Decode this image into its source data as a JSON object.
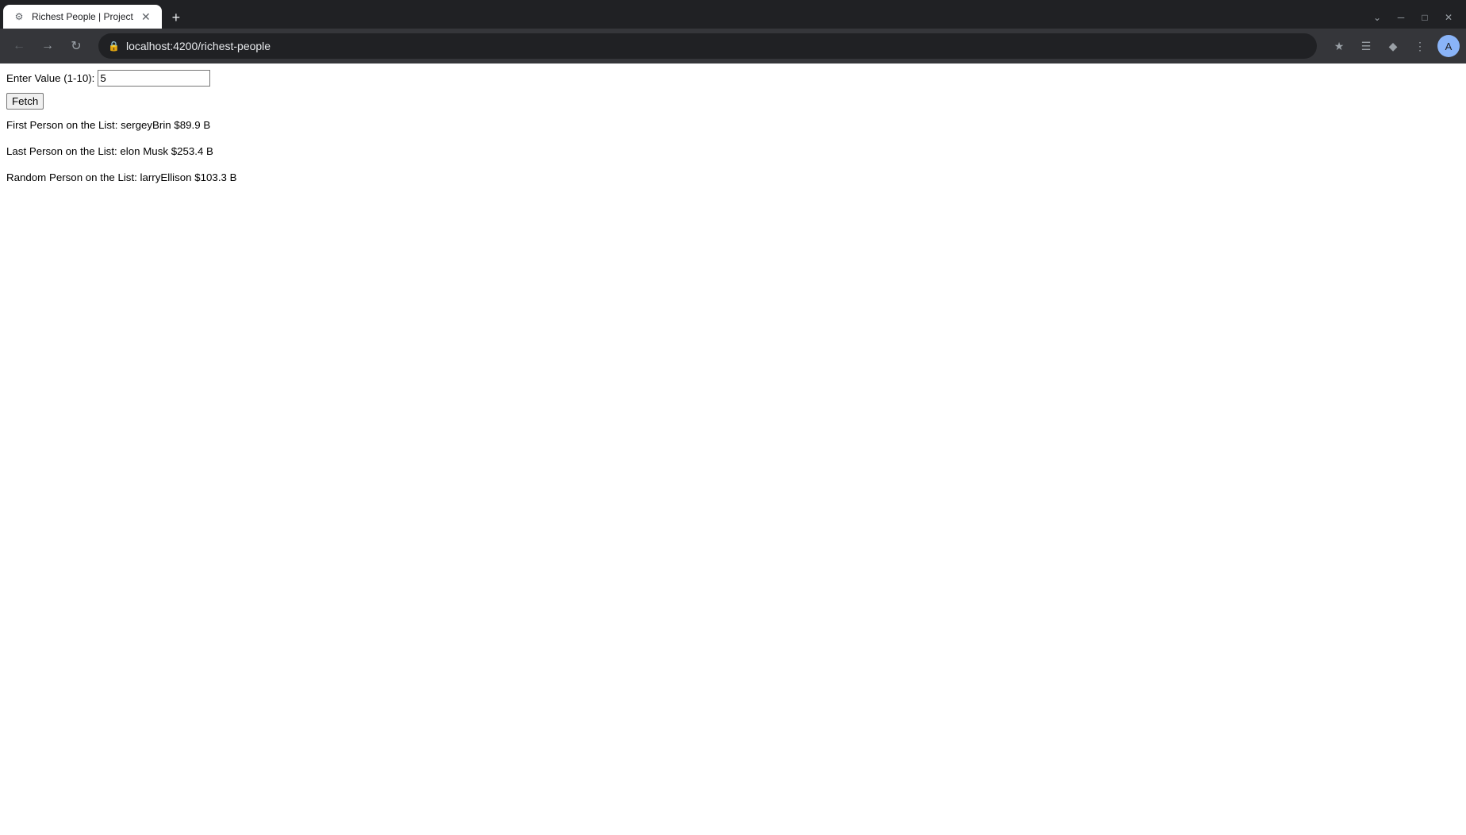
{
  "browser": {
    "tab_title": "Richest People | Project",
    "tab_favicon": "●",
    "address": "localhost:4200/richest-people",
    "profile_initial": "A",
    "dropdown_icon": "⌄",
    "minimize_icon": "─",
    "maximize_icon": "□",
    "close_icon": "✕",
    "new_tab_icon": "+"
  },
  "page": {
    "label": "Enter Value (1-10):",
    "input_value": "5",
    "input_placeholder": "",
    "fetch_button": "Fetch",
    "first_person_label": "First Person on the List: sergeyBrin $89.9 B",
    "last_person_label": "Last Person on the List: elon Musk $253.4 B",
    "random_person_label": "Random Person on the List: larryEllison $103.3 B"
  }
}
